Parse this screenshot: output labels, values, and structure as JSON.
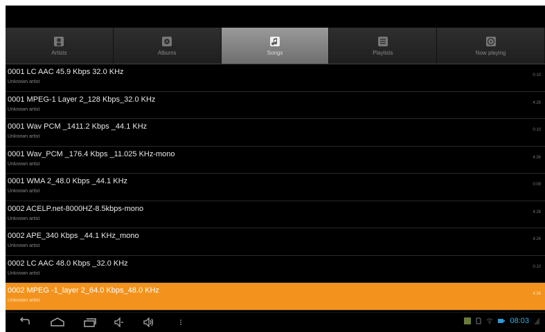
{
  "tabs": [
    {
      "label": "Artists",
      "icon": "artist-icon"
    },
    {
      "label": "Albums",
      "icon": "album-icon"
    },
    {
      "label": "Songs",
      "icon": "songs-icon",
      "active": true
    },
    {
      "label": "Playlists",
      "icon": "playlist-icon"
    },
    {
      "label": "Now playing",
      "icon": "now-playing-icon"
    }
  ],
  "songs": [
    {
      "title": "0001 LC AAC 45.9 Kbps 32.0 KHz",
      "artist": "Unknown artist",
      "duration": "0:10"
    },
    {
      "title": "0001 MPEG-1 Layer 2_128 Kbps_32.0 KHz",
      "artist": "Unknown artist",
      "duration": "4:26"
    },
    {
      "title": "0001 Wav PCM _1411.2 Kbps _44.1 KHz",
      "artist": "Unknown artist",
      "duration": "0:10"
    },
    {
      "title": "0001 Wav_PCM _176.4 Kbps _11.025 KHz-mono",
      "artist": "Unknown artist",
      "duration": "4:26"
    },
    {
      "title": "0001 WMA 2_48.0 Kbps _44.1 KHz",
      "artist": "Unknown artist",
      "duration": "0:09"
    },
    {
      "title": "0002 ACELP.net-8000HZ-8.5kbps-mono",
      "artist": "Unknown artist",
      "duration": "4:26"
    },
    {
      "title": "0002 APE_340 Kbps _44.1 KHz_mono",
      "artist": "Unknown artist",
      "duration": "4:26"
    },
    {
      "title": "0002 LC AAC 48.0 Kbps _32.0 KHz",
      "artist": "Unknown artist",
      "duration": "0:10"
    },
    {
      "title": "0002 MPEG -1_layer 2_64.0 Kbps_48.0 KHz",
      "artist": "Unknown artist",
      "duration": "4:26",
      "selected": true
    }
  ],
  "status": {
    "clock": "08:03"
  },
  "colors": {
    "selected_row": "#f3931d",
    "clock": "#33b5e5"
  }
}
